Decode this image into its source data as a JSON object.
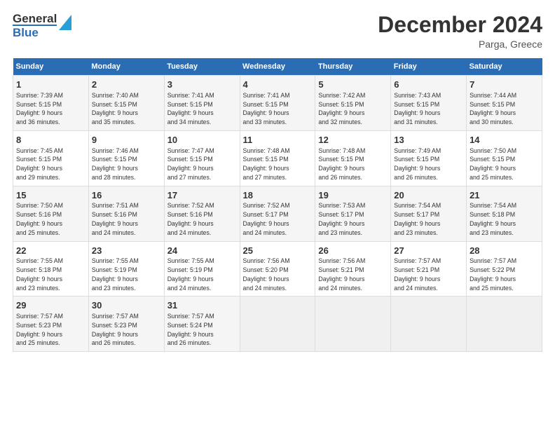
{
  "logo": {
    "line1": "General",
    "line2": "Blue"
  },
  "title": "December 2024",
  "location": "Parga, Greece",
  "days_of_week": [
    "Sunday",
    "Monday",
    "Tuesday",
    "Wednesday",
    "Thursday",
    "Friday",
    "Saturday"
  ],
  "weeks": [
    [
      {
        "day": "1",
        "info": "Sunrise: 7:39 AM\nSunset: 5:15 PM\nDaylight: 9 hours\nand 36 minutes."
      },
      {
        "day": "2",
        "info": "Sunrise: 7:40 AM\nSunset: 5:15 PM\nDaylight: 9 hours\nand 35 minutes."
      },
      {
        "day": "3",
        "info": "Sunrise: 7:41 AM\nSunset: 5:15 PM\nDaylight: 9 hours\nand 34 minutes."
      },
      {
        "day": "4",
        "info": "Sunrise: 7:41 AM\nSunset: 5:15 PM\nDaylight: 9 hours\nand 33 minutes."
      },
      {
        "day": "5",
        "info": "Sunrise: 7:42 AM\nSunset: 5:15 PM\nDaylight: 9 hours\nand 32 minutes."
      },
      {
        "day": "6",
        "info": "Sunrise: 7:43 AM\nSunset: 5:15 PM\nDaylight: 9 hours\nand 31 minutes."
      },
      {
        "day": "7",
        "info": "Sunrise: 7:44 AM\nSunset: 5:15 PM\nDaylight: 9 hours\nand 30 minutes."
      }
    ],
    [
      {
        "day": "8",
        "info": "Sunrise: 7:45 AM\nSunset: 5:15 PM\nDaylight: 9 hours\nand 29 minutes."
      },
      {
        "day": "9",
        "info": "Sunrise: 7:46 AM\nSunset: 5:15 PM\nDaylight: 9 hours\nand 28 minutes."
      },
      {
        "day": "10",
        "info": "Sunrise: 7:47 AM\nSunset: 5:15 PM\nDaylight: 9 hours\nand 27 minutes."
      },
      {
        "day": "11",
        "info": "Sunrise: 7:48 AM\nSunset: 5:15 PM\nDaylight: 9 hours\nand 27 minutes."
      },
      {
        "day": "12",
        "info": "Sunrise: 7:48 AM\nSunset: 5:15 PM\nDaylight: 9 hours\nand 26 minutes."
      },
      {
        "day": "13",
        "info": "Sunrise: 7:49 AM\nSunset: 5:15 PM\nDaylight: 9 hours\nand 26 minutes."
      },
      {
        "day": "14",
        "info": "Sunrise: 7:50 AM\nSunset: 5:15 PM\nDaylight: 9 hours\nand 25 minutes."
      }
    ],
    [
      {
        "day": "15",
        "info": "Sunrise: 7:50 AM\nSunset: 5:16 PM\nDaylight: 9 hours\nand 25 minutes."
      },
      {
        "day": "16",
        "info": "Sunrise: 7:51 AM\nSunset: 5:16 PM\nDaylight: 9 hours\nand 24 minutes."
      },
      {
        "day": "17",
        "info": "Sunrise: 7:52 AM\nSunset: 5:16 PM\nDaylight: 9 hours\nand 24 minutes."
      },
      {
        "day": "18",
        "info": "Sunrise: 7:52 AM\nSunset: 5:17 PM\nDaylight: 9 hours\nand 24 minutes."
      },
      {
        "day": "19",
        "info": "Sunrise: 7:53 AM\nSunset: 5:17 PM\nDaylight: 9 hours\nand 23 minutes."
      },
      {
        "day": "20",
        "info": "Sunrise: 7:54 AM\nSunset: 5:17 PM\nDaylight: 9 hours\nand 23 minutes."
      },
      {
        "day": "21",
        "info": "Sunrise: 7:54 AM\nSunset: 5:18 PM\nDaylight: 9 hours\nand 23 minutes."
      }
    ],
    [
      {
        "day": "22",
        "info": "Sunrise: 7:55 AM\nSunset: 5:18 PM\nDaylight: 9 hours\nand 23 minutes."
      },
      {
        "day": "23",
        "info": "Sunrise: 7:55 AM\nSunset: 5:19 PM\nDaylight: 9 hours\nand 23 minutes."
      },
      {
        "day": "24",
        "info": "Sunrise: 7:55 AM\nSunset: 5:19 PM\nDaylight: 9 hours\nand 24 minutes."
      },
      {
        "day": "25",
        "info": "Sunrise: 7:56 AM\nSunset: 5:20 PM\nDaylight: 9 hours\nand 24 minutes."
      },
      {
        "day": "26",
        "info": "Sunrise: 7:56 AM\nSunset: 5:21 PM\nDaylight: 9 hours\nand 24 minutes."
      },
      {
        "day": "27",
        "info": "Sunrise: 7:57 AM\nSunset: 5:21 PM\nDaylight: 9 hours\nand 24 minutes."
      },
      {
        "day": "28",
        "info": "Sunrise: 7:57 AM\nSunset: 5:22 PM\nDaylight: 9 hours\nand 25 minutes."
      }
    ],
    [
      {
        "day": "29",
        "info": "Sunrise: 7:57 AM\nSunset: 5:23 PM\nDaylight: 9 hours\nand 25 minutes."
      },
      {
        "day": "30",
        "info": "Sunrise: 7:57 AM\nSunset: 5:23 PM\nDaylight: 9 hours\nand 26 minutes."
      },
      {
        "day": "31",
        "info": "Sunrise: 7:57 AM\nSunset: 5:24 PM\nDaylight: 9 hours\nand 26 minutes."
      },
      {
        "day": "",
        "info": ""
      },
      {
        "day": "",
        "info": ""
      },
      {
        "day": "",
        "info": ""
      },
      {
        "day": "",
        "info": ""
      }
    ]
  ]
}
